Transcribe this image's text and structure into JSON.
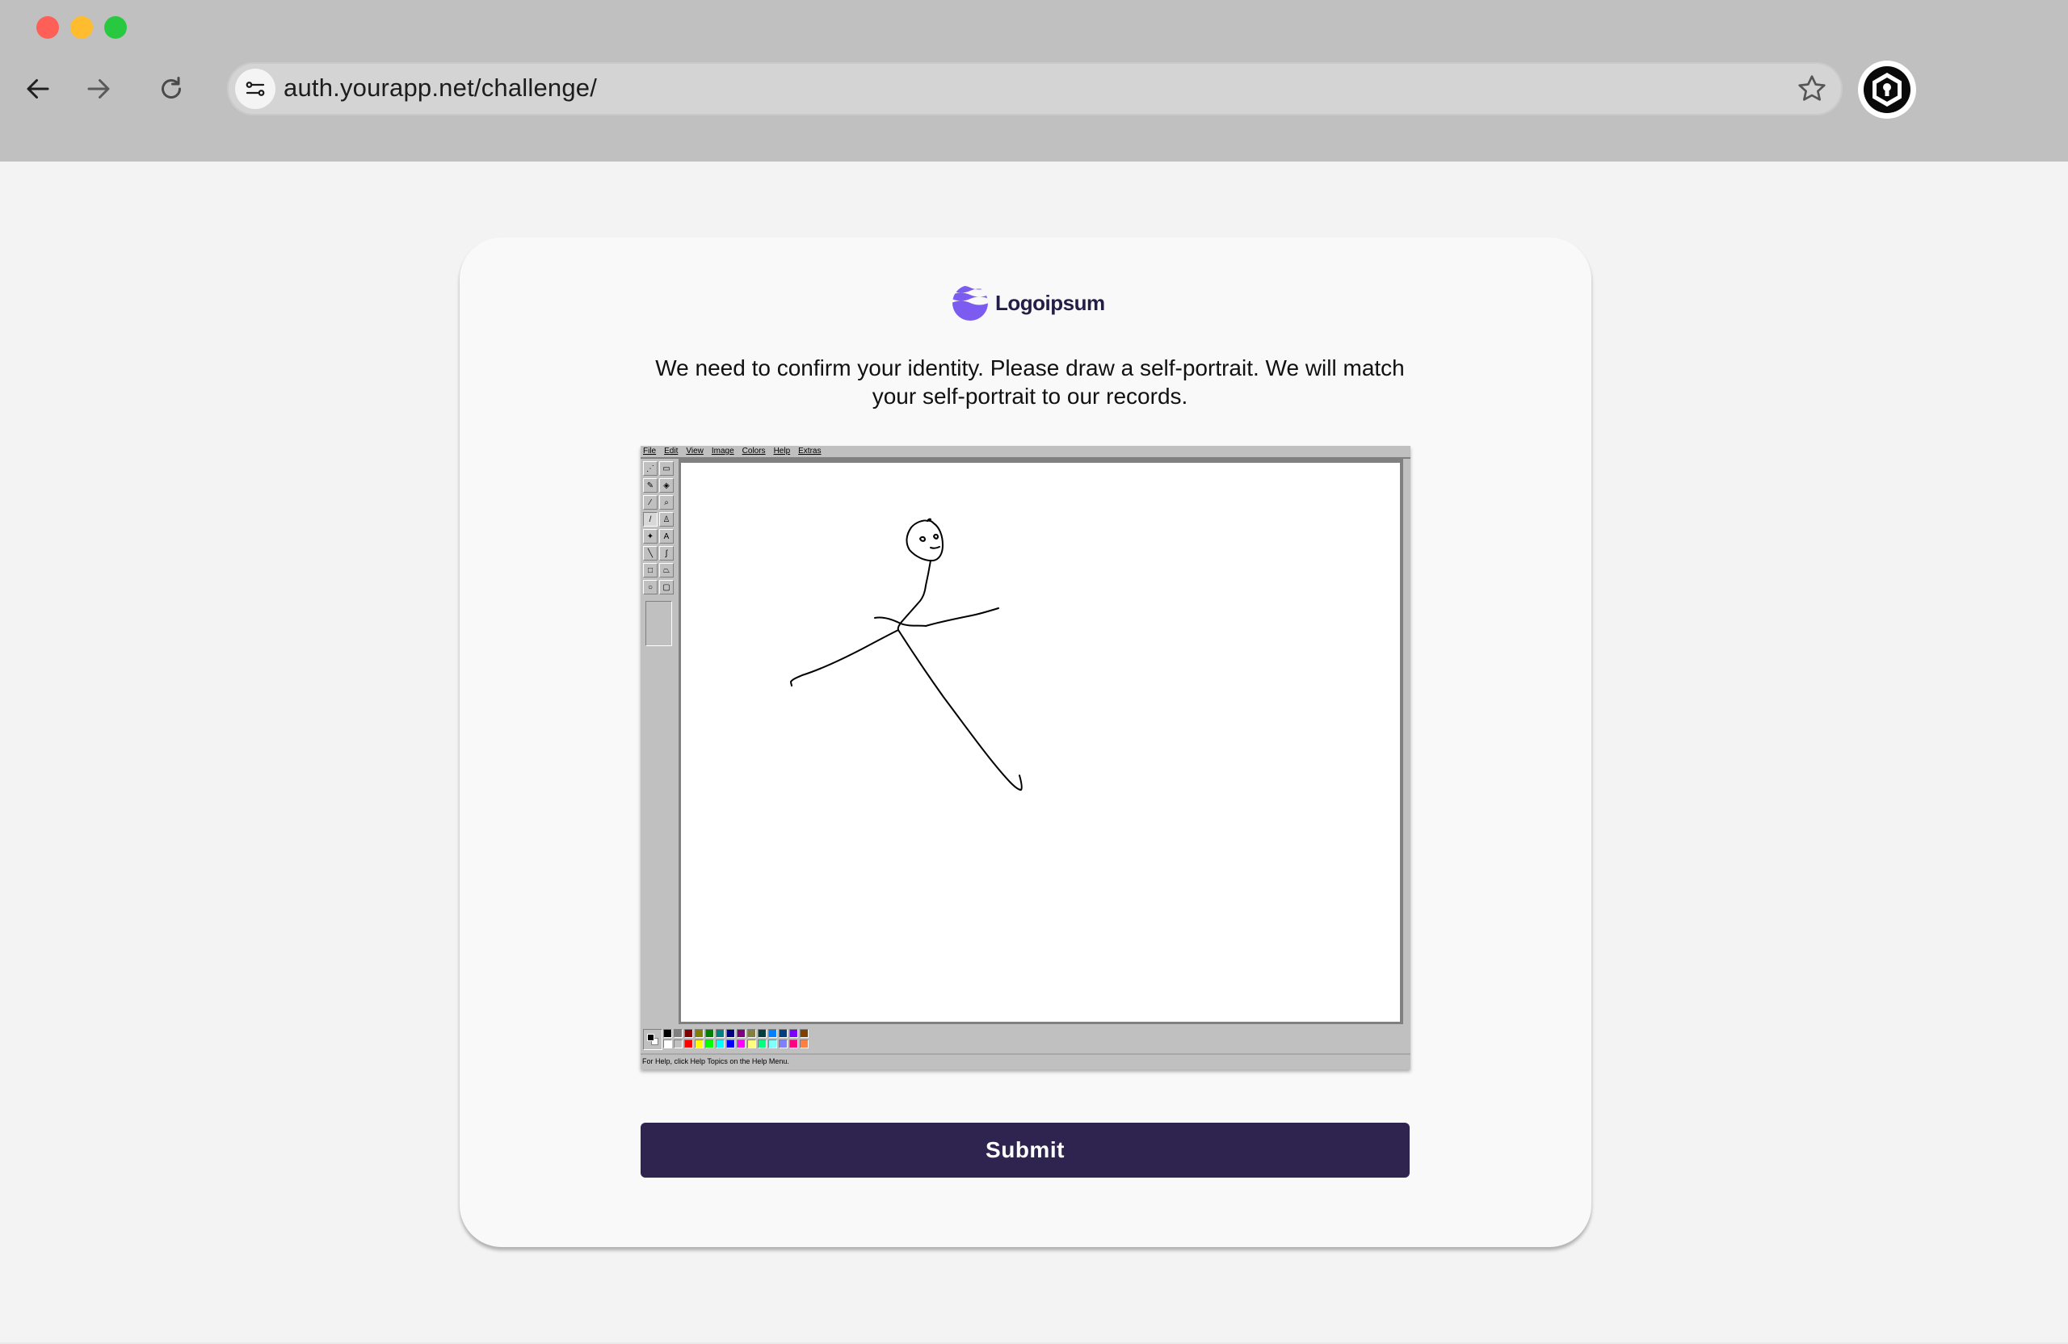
{
  "browser": {
    "url": "auth.yourapp.net/challenge/",
    "icons": {
      "back": "arrow-left-icon",
      "forward": "arrow-right-icon",
      "reload": "reload-icon",
      "site_settings": "tune-icon",
      "bookmark": "star-icon",
      "extension": "hexagon-shield-icon"
    }
  },
  "page": {
    "logo_text": "Logoipsum",
    "prompt": "We need to confirm your identity. Please draw a self-portrait. We will match your self-portrait to our records.",
    "submit_label": "Submit"
  },
  "paint": {
    "menu": [
      "File",
      "Edit",
      "View",
      "Image",
      "Colors",
      "Help",
      "Extras"
    ],
    "status": "For Help, click Help Topics on the Help Menu.",
    "palette_top": [
      "#000000",
      "#808080",
      "#800000",
      "#808000",
      "#008000",
      "#008080",
      "#000080",
      "#800080",
      "#808040",
      "#004040",
      "#0080ff",
      "#004080",
      "#8000ff",
      "#804000"
    ],
    "palette_bottom": [
      "#ffffff",
      "#c0c0c0",
      "#ff0000",
      "#ffff00",
      "#00ff00",
      "#00ffff",
      "#0000ff",
      "#ff00ff",
      "#ffff80",
      "#00ff80",
      "#80ffff",
      "#8080ff",
      "#ff0080",
      "#ff8040"
    ]
  },
  "colors": {
    "accent": "#2f2450",
    "logo_purple": "#7c5cf0",
    "chrome": "#c0c0c0"
  }
}
